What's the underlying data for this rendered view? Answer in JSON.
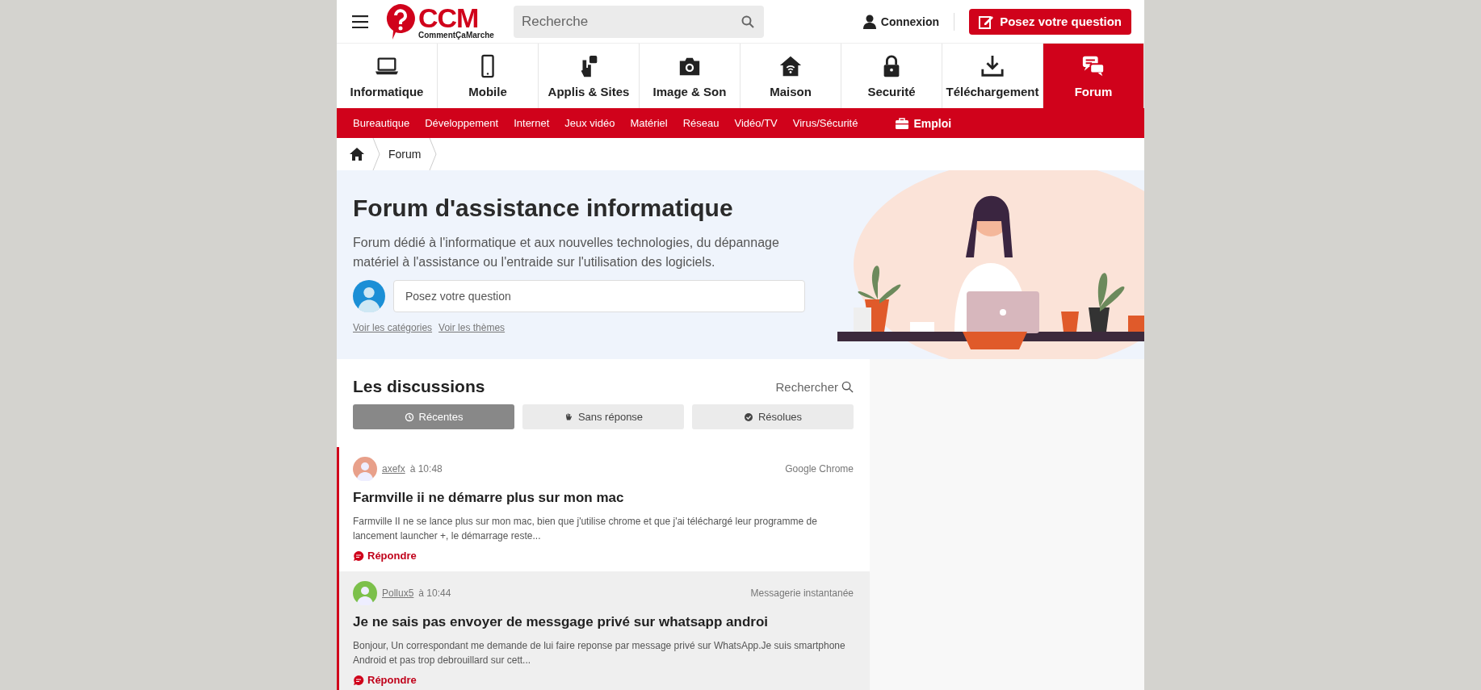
{
  "header": {
    "logo_text": "CCM",
    "logo_subtext": "CommentÇaMarche",
    "search": {
      "placeholder": "Recherche"
    },
    "login": "Connexion",
    "ask_button": "Posez votre question"
  },
  "categories": [
    {
      "label": "Informatique",
      "selected": false
    },
    {
      "label": "Mobile",
      "selected": false
    },
    {
      "label": "Applis & Sites",
      "selected": false
    },
    {
      "label": "Image & Son",
      "selected": false
    },
    {
      "label": "Maison",
      "selected": false
    },
    {
      "label": "Securité",
      "selected": false
    },
    {
      "label": "Téléchargement",
      "selected": false
    },
    {
      "label": "Forum",
      "selected": true
    }
  ],
  "subnav": [
    "Bureautique",
    "Développement",
    "Internet",
    "Jeux vidéo",
    "Matériel",
    "Réseau",
    "Vidéo/TV",
    "Virus/Sécurité"
  ],
  "subnav_job": "Emploi",
  "breadcrumb": [
    "Forum"
  ],
  "hero": {
    "title": "Forum d'assistance informatique",
    "description": "Forum dédié à l'informatique et aux nouvelles technologies, du dépannage matériel à l'assistance ou l'entraide sur l'utilisation des logiciels.",
    "question": {
      "placeholder": "Posez votre question"
    },
    "links": [
      "Voir les catégories",
      "Voir les thèmes"
    ]
  },
  "discussions": {
    "title": "Les discussions",
    "search_label": "Rechercher",
    "tabs": [
      {
        "label": "Récentes",
        "selected": true
      },
      {
        "label": "Sans réponse",
        "selected": false
      },
      {
        "label": "Résolues",
        "selected": false
      }
    ],
    "threads": [
      {
        "author": "axefx",
        "time": "à 10:48",
        "category": "Google Chrome",
        "title": "Farmville ii ne démarre plus sur mon mac",
        "excerpt": "Farmville II ne se lance plus sur mon mac, bien que j'utilise chrome et que j'ai téléchargé leur programme de lancement launcher +, le démarrage reste...",
        "reply": "Répondre",
        "highlighted": false
      },
      {
        "author": "Pollux5",
        "time": "à 10:44",
        "category": "Messagerie instantanée",
        "title": "Je ne sais pas envoyer de messgage privé sur whatsapp androi",
        "excerpt": "Bonjour, Un correspondant me demande de lui faire reponse par message privé sur WhatsApp.Je suis smartphone Android et pas trop debrouillard sur cett...",
        "reply": "Répondre",
        "highlighted": true
      }
    ]
  }
}
